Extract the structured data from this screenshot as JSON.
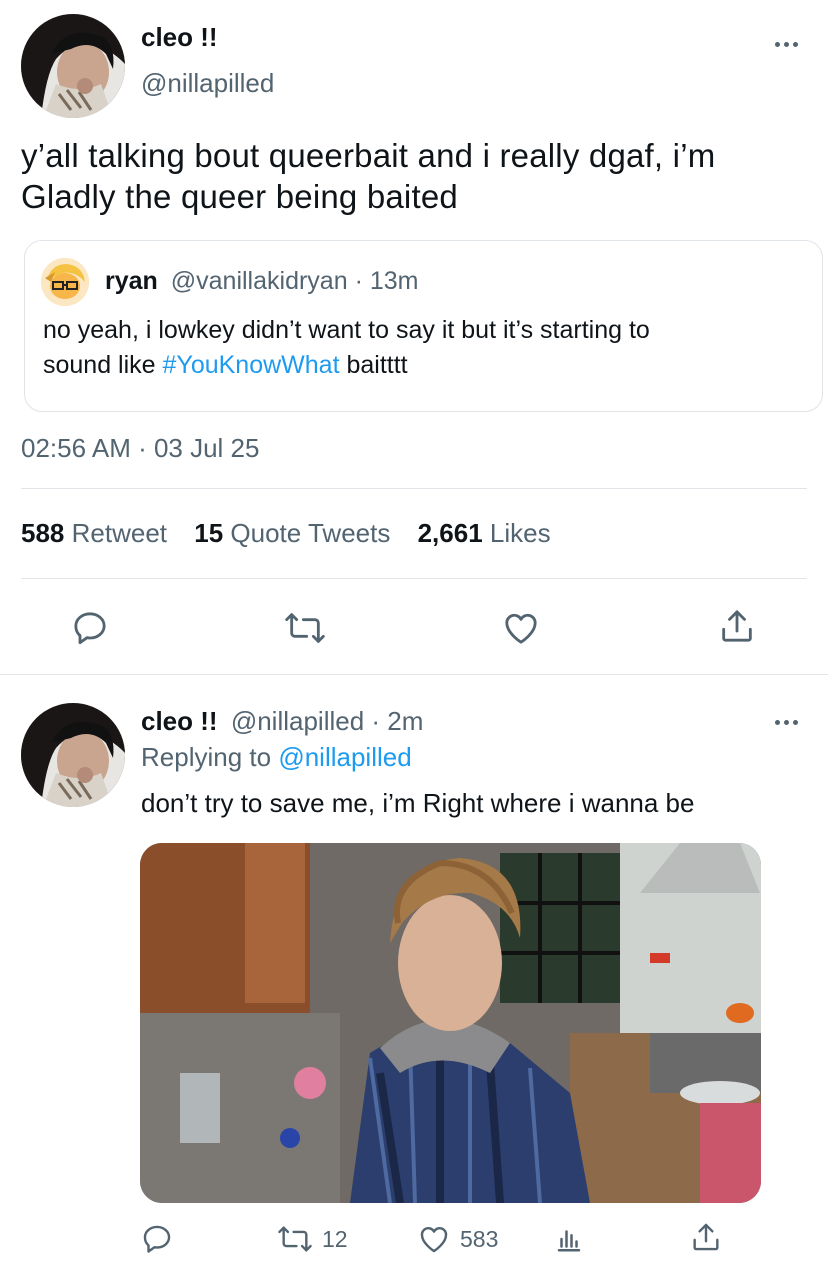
{
  "main_tweet": {
    "display_name": "cleo !!",
    "handle": "@nillapilled",
    "text_line1": "y’all talking bout queerbait and i really dgaf, i’m",
    "text_line2": "Gladly the queer being baited",
    "quoted": {
      "display_name": "ryan",
      "handle": "@vanillakidryan",
      "time": "· 13m",
      "text_line1": "no yeah, i lowkey didn’t want to say it but it’s starting to",
      "text_line2_pre": "sound like",
      "hashtag": "#YouKnowWhat",
      "text_line2_post": "baitttt"
    },
    "timestamp": "02:56 AM · 03 Jul 25",
    "stats": {
      "retweets_count": "588",
      "retweets_label": "Retweet",
      "quotes_count": "15",
      "quotes_label": "Quote Tweets",
      "likes_count": "2,661",
      "likes_label": "Likes"
    },
    "actions": [
      "reply-icon",
      "retweet-icon",
      "like-icon",
      "share-icon"
    ]
  },
  "reply_tweet": {
    "display_name": "cleo !!",
    "handle": "@nillapilled",
    "time": "· 2m",
    "replying_label": "Replying to",
    "replying_handle": "@nillapilled",
    "text": "don’t try to save me, i’m Right where i wanna be",
    "retweet_count": "12",
    "like_count": "583",
    "actions": [
      "reply-icon",
      "retweet-icon",
      "like-icon",
      "analytics-icon",
      "share-icon"
    ]
  },
  "colors": {
    "accent": "#1d9bf0",
    "muted": "#536471",
    "border": "#e1e5e9"
  }
}
